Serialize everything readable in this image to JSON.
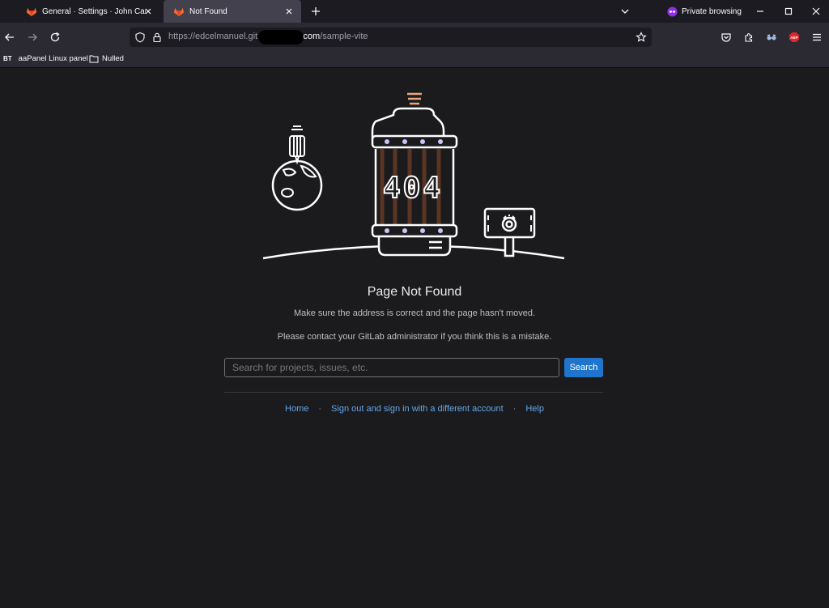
{
  "browser": {
    "tabs": [
      {
        "title": "General · Settings · John Carl Ed",
        "active": false
      },
      {
        "title": "Not Found",
        "active": true
      }
    ],
    "private_label": "Private browsing",
    "url_prefix": "https://edcelmanuel.git.",
    "url_domain_tail": "ub.com",
    "url_path": "/sample-vite",
    "bookmarks": [
      {
        "badge": "BT",
        "label": "aaPanel Linux panel"
      },
      {
        "label": "Nulled"
      }
    ],
    "colors": {
      "tabstrip": "#1c1b22",
      "toolbar": "#2b2a33",
      "active_tab": "#42414d"
    }
  },
  "page": {
    "illustration_text": "404",
    "heading": "Page Not Found",
    "line1": "Make sure the address is correct and the page hasn't moved.",
    "line2": "Please contact your GitLab administrator if you think this is a mistake.",
    "search": {
      "placeholder": "Search for projects, issues, etc.",
      "button": "Search"
    },
    "links": [
      "Home",
      "Sign out and sign in with a different account",
      "Help"
    ],
    "colors": {
      "background": "#1b1b1d",
      "link": "#63a6e9",
      "button": "#1f75cb"
    }
  }
}
